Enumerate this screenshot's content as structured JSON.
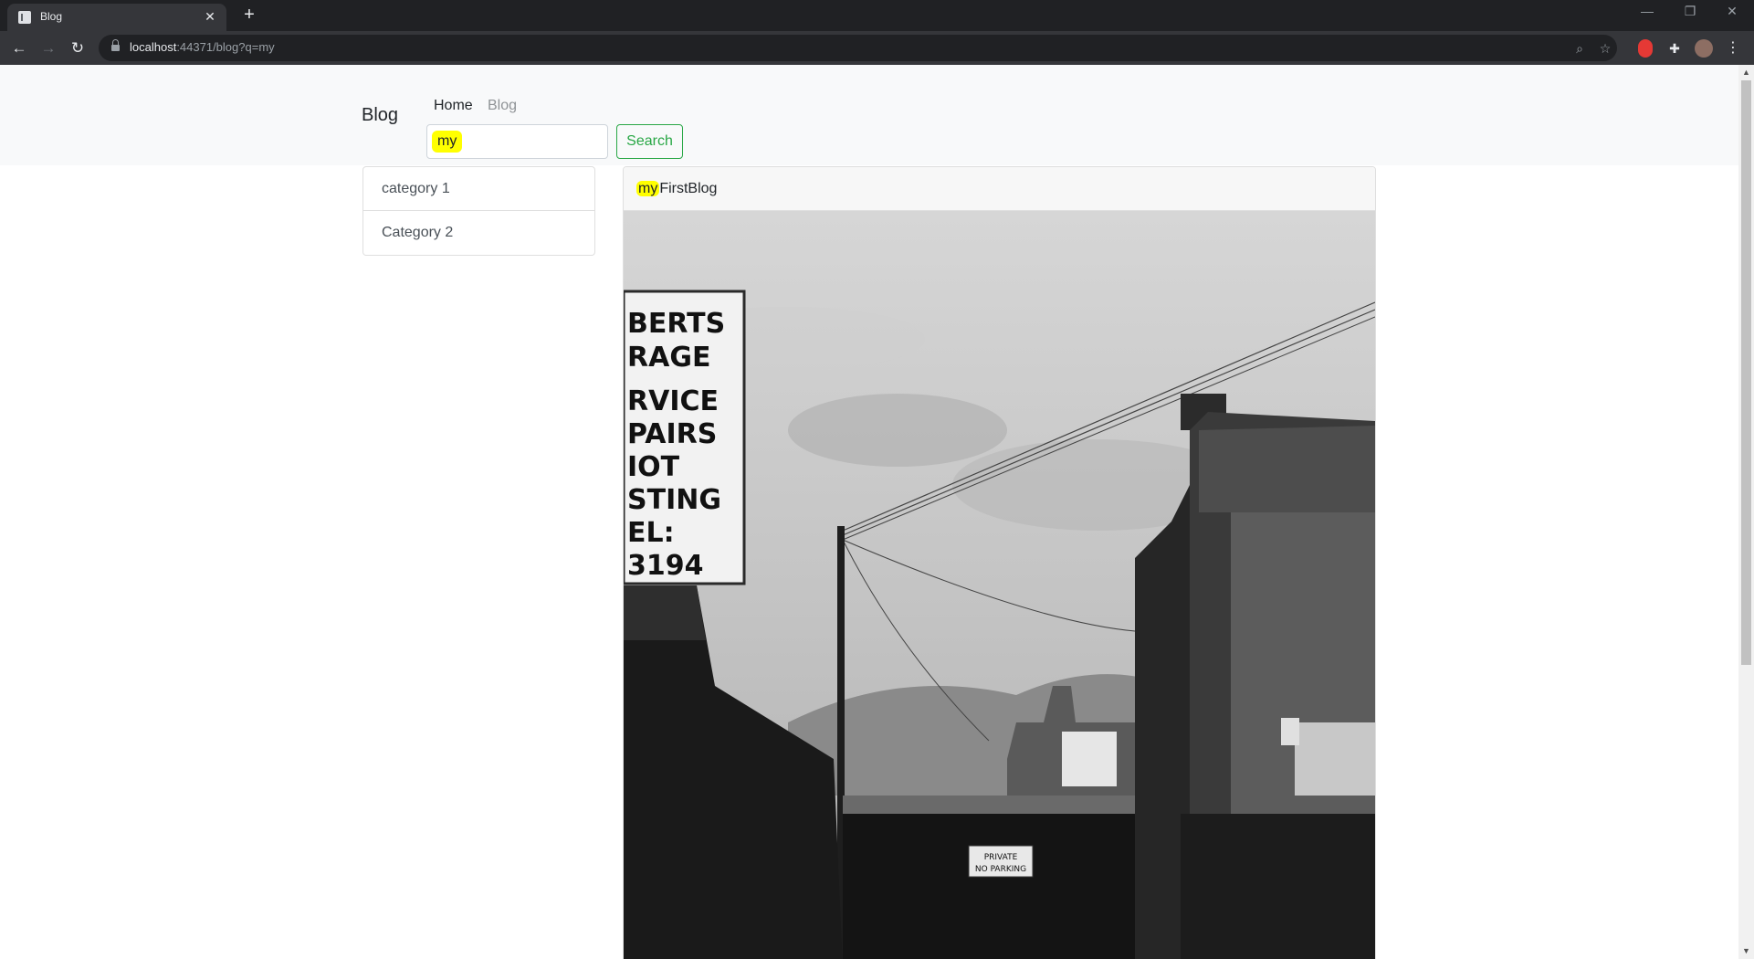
{
  "browser": {
    "tab_title": "Blog",
    "url_host": "localhost",
    "url_rest": ":44371/blog?q=my"
  },
  "navbar": {
    "brand": "Blog",
    "links": [
      {
        "label": "Home"
      },
      {
        "label": "Blog"
      }
    ],
    "search": {
      "value": "my",
      "button_label": "Search"
    },
    "colors": {
      "search_button": "#28a745",
      "highlight": "#ffff00"
    }
  },
  "sidebar": {
    "categories": [
      {
        "label": "category 1"
      },
      {
        "label": "Category 2"
      }
    ]
  },
  "post": {
    "title_highlight": "my",
    "title_rest": "FirstBlog",
    "image_sign_lines": [
      "BERTS",
      "RAGE",
      "RVICE",
      "PAIRS",
      "IOT",
      "STING",
      "EL:",
      "3194"
    ],
    "image_private_sign": [
      "PRIVATE",
      "NO PARKING"
    ]
  }
}
